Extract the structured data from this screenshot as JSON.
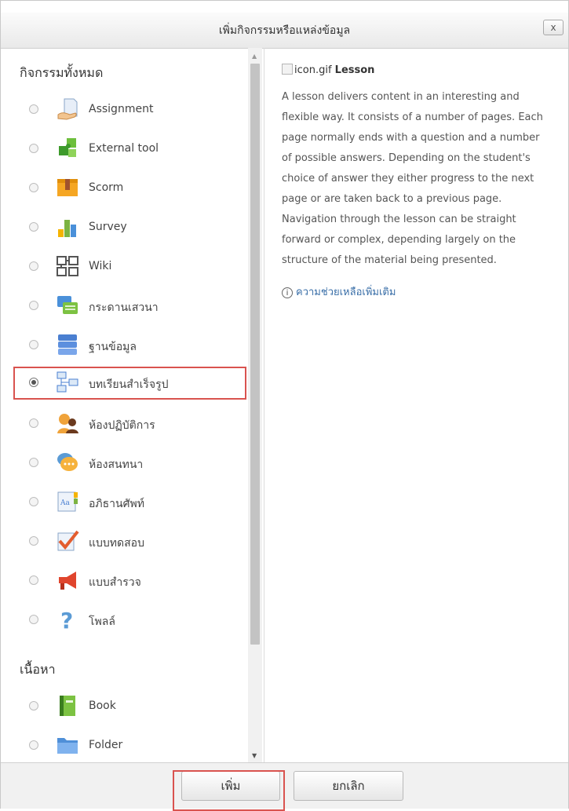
{
  "dialog": {
    "title": "เพิ่มกิจกรรมหรือแหล่งข้อมูล",
    "close_label": "x"
  },
  "sections": [
    {
      "label": "กิจกรรมทั้งหมด",
      "items": [
        {
          "label": "Assignment",
          "icon": "assignment-icon",
          "selected": false
        },
        {
          "label": "External tool",
          "icon": "puzzle-icon",
          "selected": false
        },
        {
          "label": "Scorm",
          "icon": "scorm-package-icon",
          "selected": false
        },
        {
          "label": "Survey",
          "icon": "bar-chart-icon",
          "selected": false
        },
        {
          "label": "Wiki",
          "icon": "wiki-icon",
          "selected": false
        },
        {
          "label": "กระดานเสวนา",
          "icon": "forum-icon",
          "selected": false
        },
        {
          "label": "ฐานข้อมูล",
          "icon": "database-icon",
          "selected": false
        },
        {
          "label": "บทเรียนสำเร็จรูป",
          "icon": "lesson-icon",
          "selected": true
        },
        {
          "label": "ห้องปฏิบัติการ",
          "icon": "workshop-icon",
          "selected": false
        },
        {
          "label": "ห้องสนทนา",
          "icon": "chat-icon",
          "selected": false
        },
        {
          "label": "อภิธานศัพท์",
          "icon": "glossary-icon",
          "selected": false
        },
        {
          "label": "แบบทดสอบ",
          "icon": "quiz-icon",
          "selected": false
        },
        {
          "label": "แบบสำรวจ",
          "icon": "megaphone-icon",
          "selected": false
        },
        {
          "label": "โพลล์",
          "icon": "question-mark-icon",
          "selected": false
        }
      ]
    },
    {
      "label": "เนื้อหา",
      "items": [
        {
          "label": "Book",
          "icon": "book-icon",
          "selected": false
        },
        {
          "label": "Folder",
          "icon": "folder-icon",
          "selected": false
        }
      ]
    }
  ],
  "description": {
    "image_alt": "icon.gif",
    "title": "Lesson",
    "text": "A lesson delivers content in an interesting and flexible way. It consists of a number of pages. Each page normally ends with a question and a number of possible answers. Depending on the student's choice of answer they either progress to the next page or are taken back to a previous page. Navigation through the lesson can be straight forward or complex, depending largely on the structure of the material being presented.",
    "help_link": "ความช่วยเหลือเพิ่มเติม",
    "info_glyph": "i"
  },
  "footer": {
    "add_label": "เพิ่ม",
    "cancel_label": "ยกเลิก"
  },
  "colors": {
    "highlight": "#d9534f",
    "link": "#3a6fa8"
  }
}
